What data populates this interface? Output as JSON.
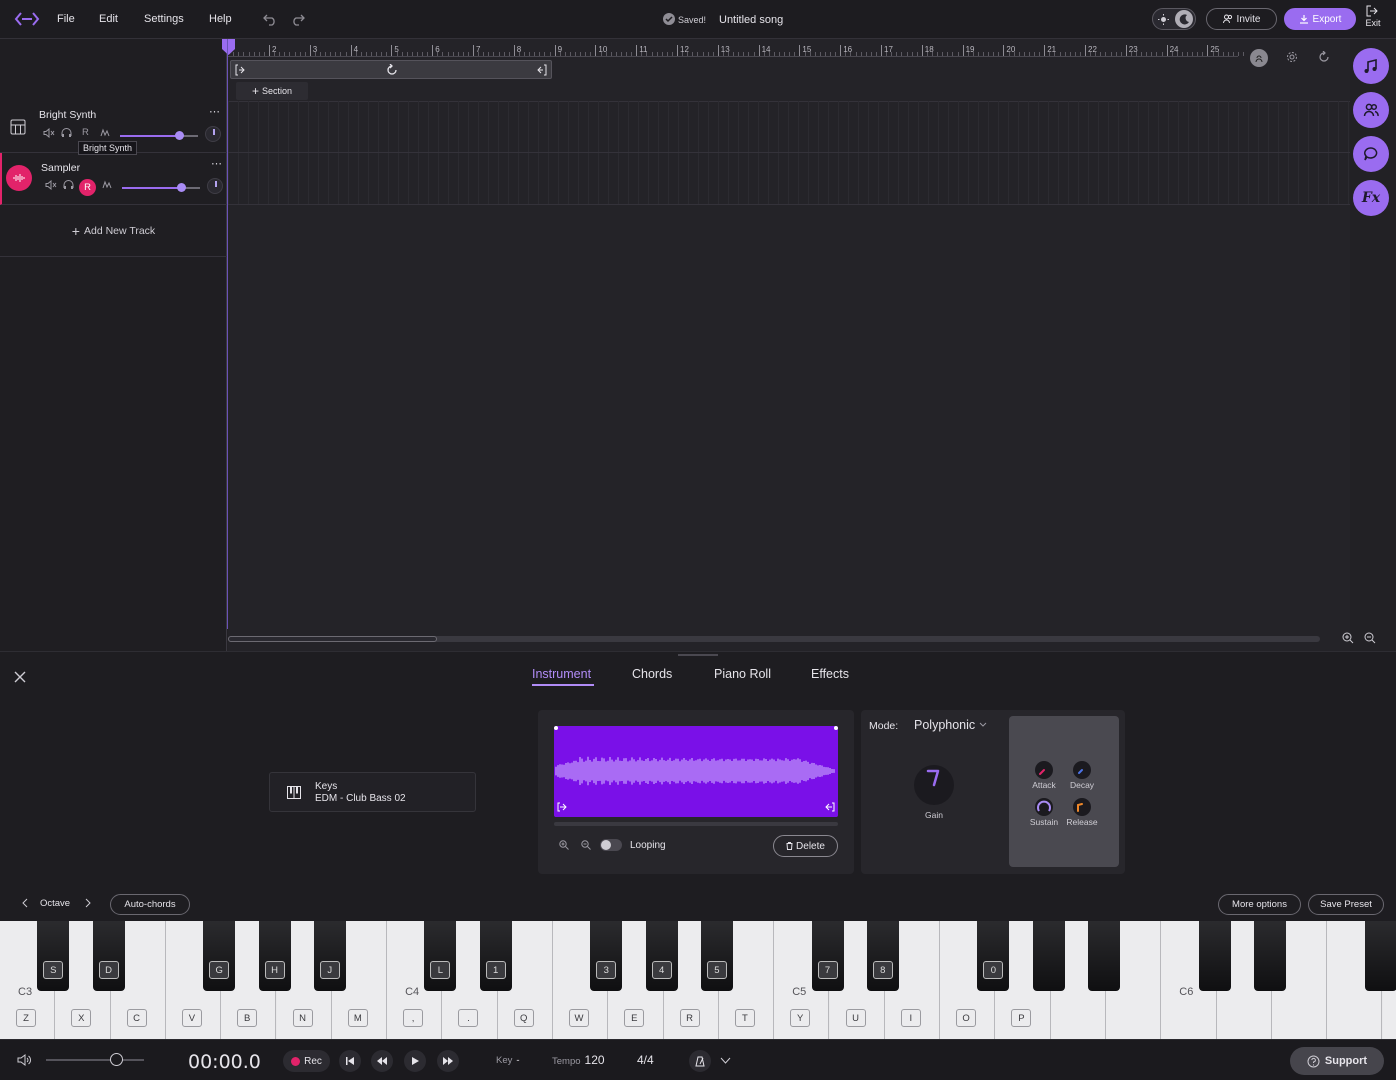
{
  "app": {
    "menu": [
      "File",
      "Edit",
      "Settings",
      "Help"
    ],
    "saved_status": "Saved!",
    "song_title": "Untitled song",
    "invite_label": "Invite",
    "export_label": "Export",
    "exit_label": "Exit"
  },
  "ruler": {
    "marks": [
      "2",
      "3",
      "4",
      "5",
      "6",
      "7",
      "8",
      "9",
      "10",
      "11",
      "12",
      "13",
      "14",
      "15",
      "16",
      "17",
      "18",
      "19",
      "20",
      "21",
      "22",
      "23",
      "24",
      "25"
    ]
  },
  "section": {
    "add_label": "Section"
  },
  "tracks": [
    {
      "name": "Bright Synth",
      "tooltip": "Bright Synth",
      "rec_label": "R",
      "volume": 0.75,
      "more": "⋯"
    },
    {
      "name": "Sampler",
      "rec_label": "R",
      "volume": 0.75,
      "more": "⋯"
    }
  ],
  "add_track_label": "Add New Track",
  "bottom": {
    "tabs": [
      "Instrument",
      "Chords",
      "Piano Roll",
      "Effects"
    ],
    "active_tab": "Instrument",
    "instrument": {
      "category": "Keys",
      "preset": "EDM - Club Bass 02"
    },
    "sampler": {
      "looping_label": "Looping",
      "delete_label": "Delete"
    },
    "mode": {
      "label": "Mode:",
      "value": "Polyphonic"
    },
    "gain_label": "Gain",
    "envelope": [
      "Attack",
      "Decay",
      "Sustain",
      "Release"
    ],
    "octave_label": "Octave",
    "autochords_label": "Auto-chords",
    "more_options_label": "More options",
    "save_preset_label": "Save Preset"
  },
  "keyboard": {
    "white_keys": [
      "Z",
      "X",
      "C",
      "V",
      "B",
      "N",
      "M",
      ",",
      ".",
      "Q",
      "W",
      "E",
      "R",
      "T",
      "Y",
      "U",
      "I",
      "O",
      "P"
    ],
    "black_keys": [
      "S",
      "D",
      "G",
      "H",
      "J",
      "L",
      "1",
      "3",
      "4",
      "5",
      "7",
      "8",
      "0"
    ],
    "octaves": [
      "C3",
      "C4",
      "C5",
      "C6"
    ]
  },
  "transport": {
    "time": "00:00.0",
    "rec_label": "Rec",
    "key_label": "Key",
    "key_value": "-",
    "tempo_label": "Tempo",
    "tempo_value": "120",
    "time_signature": "4/4",
    "support_label": "Support"
  },
  "colors": {
    "accent": "#9a6cf0",
    "record": "#e2236a",
    "waveform_bg": "#7a10e8"
  }
}
